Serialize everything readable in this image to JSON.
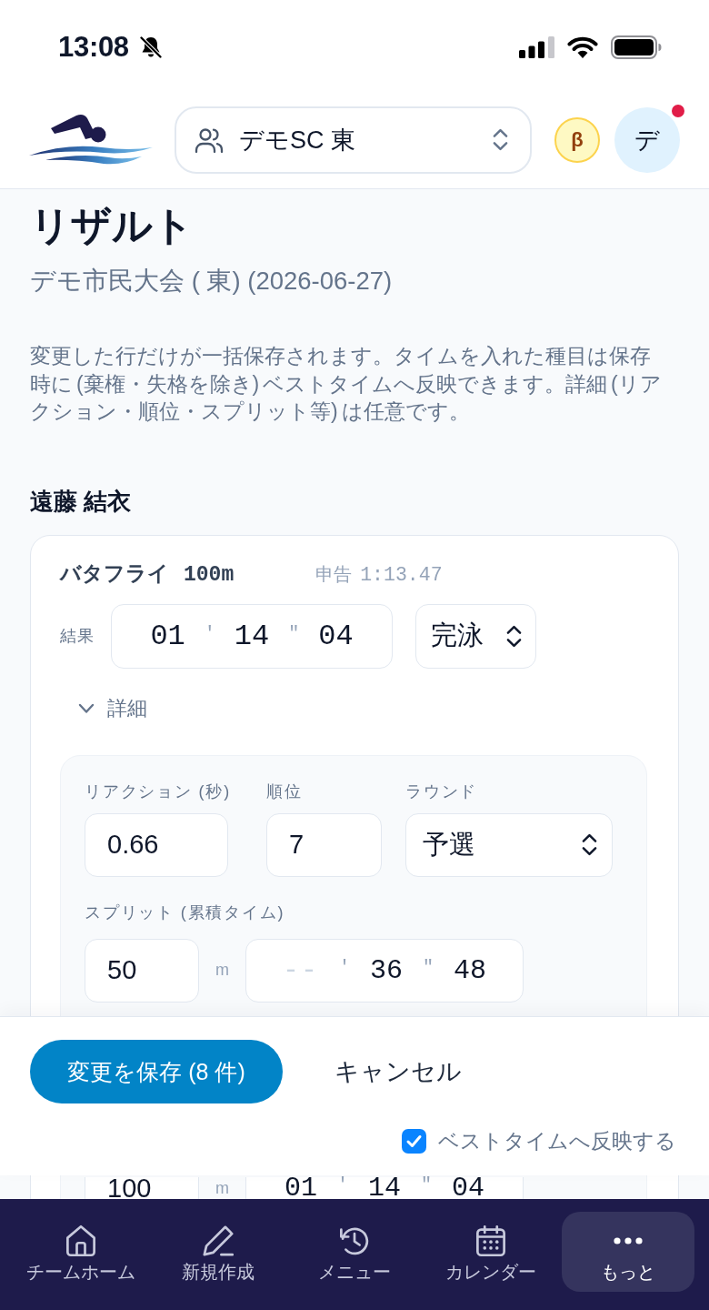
{
  "status_bar": {
    "time": "13:08"
  },
  "header": {
    "team_selector": {
      "value": "デモSC 東"
    },
    "beta_badge": "β",
    "avatar": {
      "initial": "デ",
      "notification": true
    }
  },
  "page": {
    "title": "リザルト",
    "subtitle": "デモ市民大会 ( 東) (2026-06-27)",
    "description": "変更した行だけが一括保存されます。タイムを入れた種目は保存時に (棄権・失格を除き) ベストタイムへ反映できます。詳細 (リアクション・順位・スプリット等) は任意です。"
  },
  "swimmers": [
    {
      "name": "遠藤 結衣",
      "entries": [
        {
          "event": "バタフライ",
          "distance": "100m",
          "entry_time_label": "申告",
          "entry_time": "1:13.47",
          "result_label": "結果",
          "result_time": [
            {
              "kind": "input",
              "value": "01"
            },
            {
              "kind": "mark",
              "text": "'"
            },
            {
              "kind": "input",
              "value": "14"
            },
            {
              "kind": "mark",
              "text": "\""
            },
            {
              "kind": "input",
              "value": "04"
            }
          ],
          "status": "完泳",
          "details": {
            "label": "詳細",
            "expanded": true,
            "reaction_label": "リアクション (秒)",
            "reaction": "0.66",
            "rank_label": "順位",
            "rank": "7",
            "round_label": "ラウンド",
            "round": "予選",
            "splits_label": "スプリット (累積タイム)",
            "splits": [
              {
                "distance": "50",
                "unit": "m",
                "time": [
                  {
                    "kind": "input",
                    "placeholder": "--"
                  },
                  {
                    "kind": "mark",
                    "text": "'"
                  },
                  {
                    "kind": "input",
                    "value": "36"
                  },
                  {
                    "kind": "mark",
                    "text": "\""
                  },
                  {
                    "kind": "input",
                    "value": "48"
                  }
                ]
              },
              {
                "distance": "100",
                "unit": "m",
                "time": [
                  {
                    "kind": "input",
                    "value": "01"
                  },
                  {
                    "kind": "mark",
                    "text": "'"
                  },
                  {
                    "kind": "input",
                    "value": "14"
                  },
                  {
                    "kind": "mark",
                    "text": "\""
                  },
                  {
                    "kind": "input",
                    "value": "04"
                  }
                ]
              }
            ]
          }
        }
      ]
    }
  ],
  "action_bar": {
    "save_button": "変更を保存 (8 件)",
    "cancel_button": "キャンセル",
    "reflect_best_time": {
      "label": "ベストタイムへ反映する",
      "checked": true
    }
  },
  "bottom_nav": [
    {
      "label": "チームホーム",
      "selected": false
    },
    {
      "label": "新規作成",
      "selected": false
    },
    {
      "label": "メニュー",
      "selected": false
    },
    {
      "label": "カレンダー",
      "selected": false
    },
    {
      "label": "もっと",
      "selected": true
    }
  ]
}
